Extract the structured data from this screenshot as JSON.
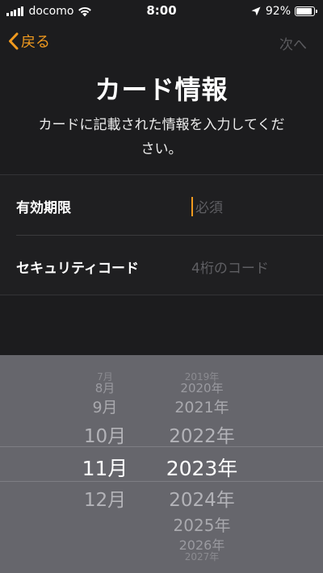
{
  "status_bar": {
    "carrier": "docomo",
    "time": "8:00",
    "battery": "92%",
    "battery_level": 0.92
  },
  "nav": {
    "back_label": "戻る",
    "next_label": "次へ"
  },
  "header": {
    "title": "カード情報",
    "subtitle": "カードに記載された情報を入力してください。"
  },
  "form": {
    "expiry": {
      "label": "有効期限",
      "placeholder": "必須"
    },
    "security_code": {
      "label": "セキュリティコード",
      "placeholder": "4桁のコード"
    }
  },
  "picker": {
    "months": [
      "7月",
      "8月",
      "9月",
      "10月",
      "11月",
      "12月",
      "",
      "",
      ""
    ],
    "years": [
      "2019年",
      "2020年",
      "2021年",
      "2022年",
      "2023年",
      "2024年",
      "2025年",
      "2026年",
      "2027年"
    ],
    "selected_month": "11月",
    "selected_year": "2023年"
  },
  "colors": {
    "accent": "#f19a1e",
    "background": "#1c1c1e",
    "picker_background": "#66666c"
  }
}
